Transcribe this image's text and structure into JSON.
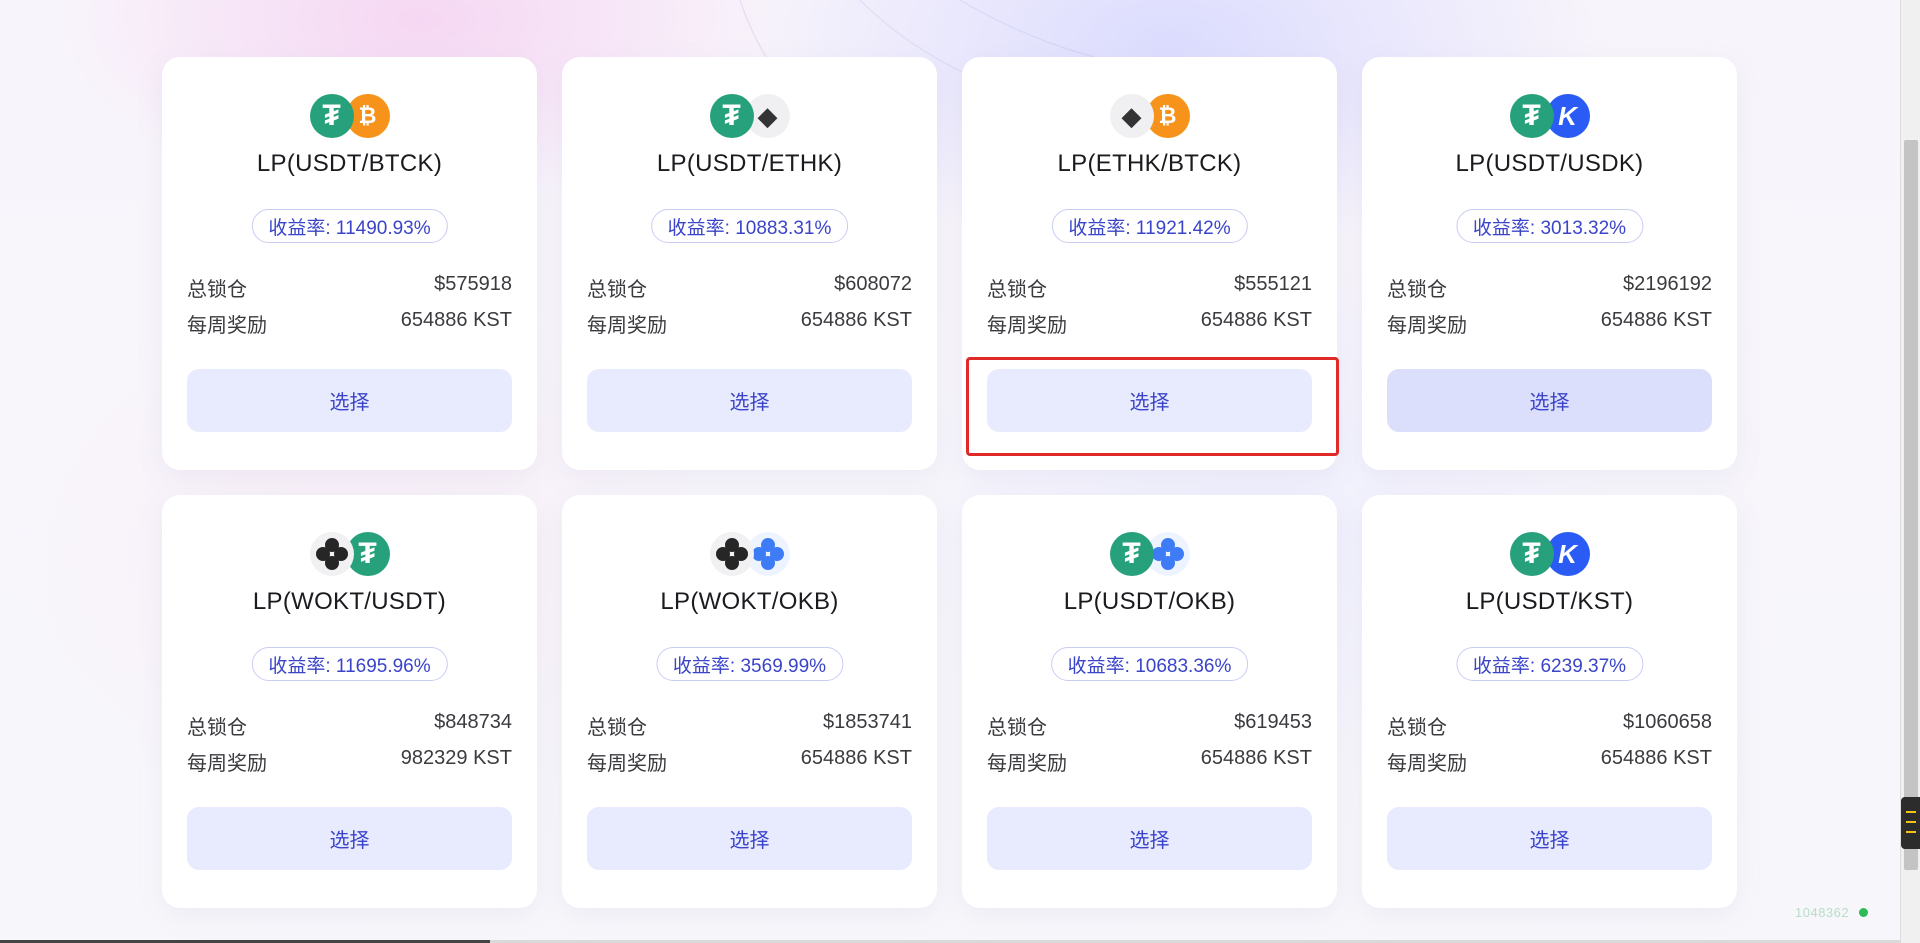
{
  "labels": {
    "tvl": "总锁仓",
    "weekly_reward": "每周奖励",
    "apy_prefix": "收益率: ",
    "select": "选择"
  },
  "pools": [
    {
      "name": "LP(USDT/BTCK)",
      "apy": "收益率: 11490.93%",
      "tvl": "$575918",
      "reward": "654886 KST",
      "icons": [
        "usdt-icon",
        "btc-icon"
      ]
    },
    {
      "name": "LP(USDT/ETHK)",
      "apy": "收益率: 10883.31%",
      "tvl": "$608072",
      "reward": "654886 KST",
      "icons": [
        "usdt-icon",
        "eth-icon"
      ]
    },
    {
      "name": "LP(ETHK/BTCK)",
      "apy": "收益率: 11921.42%",
      "tvl": "$555121",
      "reward": "654886 KST",
      "icons": [
        "eth-icon",
        "btc-icon"
      ]
    },
    {
      "name": "LP(USDT/USDK)",
      "apy": "收益率: 3013.32%",
      "tvl": "$2196192",
      "reward": "654886 KST",
      "icons": [
        "usdt-icon",
        "usdk-icon"
      ]
    },
    {
      "name": "LP(WOKT/USDT)",
      "apy": "收益率: 11695.96%",
      "tvl": "$848734",
      "reward": "982329 KST",
      "icons": [
        "wokt-icon",
        "usdt-icon"
      ]
    },
    {
      "name": "LP(WOKT/OKB)",
      "apy": "收益率: 3569.99%",
      "tvl": "$1853741",
      "reward": "654886 KST",
      "icons": [
        "wokt-icon",
        "okb-icon"
      ]
    },
    {
      "name": "LP(USDT/OKB)",
      "apy": "收益率: 10683.36%",
      "tvl": "$619453",
      "reward": "654886 KST",
      "icons": [
        "usdt-icon",
        "okb-icon"
      ]
    },
    {
      "name": "LP(USDT/KST)",
      "apy": "收益率: 6239.37%",
      "tvl": "$1060658",
      "reward": "654886 KST",
      "icons": [
        "usdt-icon",
        "kst-icon"
      ]
    }
  ],
  "status": {
    "block_number": "1048362",
    "indicator_color": "#2dbb58"
  },
  "colors": {
    "accent": "#3a44c9",
    "button_bg": "#e8eafd",
    "highlight": "#e02a2a"
  }
}
